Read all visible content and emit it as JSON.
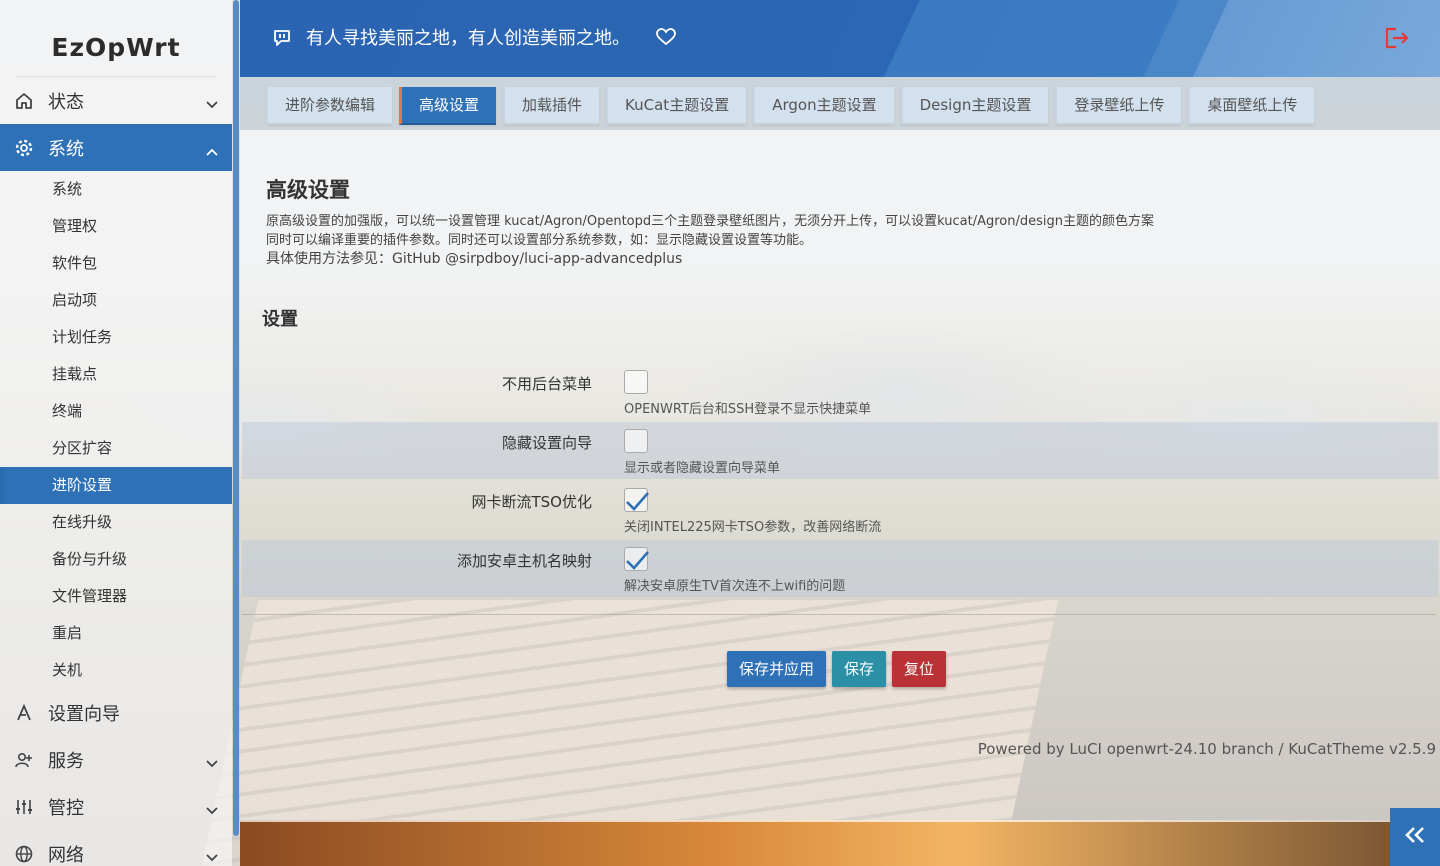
{
  "brand": "EzOpWrt",
  "header": {
    "slogan": "有人寻找美丽之地，有人创造美丽之地。"
  },
  "sidebar": {
    "items": [
      {
        "label": "状态",
        "icon": "home-icon"
      },
      {
        "label": "系统",
        "icon": "gear-icon"
      },
      {
        "label": "设置向导",
        "icon": "wizard-icon"
      },
      {
        "label": "服务",
        "icon": "user-plus-icon"
      },
      {
        "label": "管控",
        "icon": "sliders-icon"
      },
      {
        "label": "网络",
        "icon": "globe-icon"
      }
    ],
    "subitems": [
      "系统",
      "管理权",
      "软件包",
      "启动项",
      "计划任务",
      "挂载点",
      "终端",
      "分区扩容",
      "进阶设置",
      "在线升级",
      "备份与升级",
      "文件管理器",
      "重启",
      "关机"
    ],
    "active_sub": "进阶设置"
  },
  "tabs": [
    "进阶参数编辑",
    "高级设置",
    "加载插件",
    "KuCat主题设置",
    "Argon主题设置",
    "Design主题设置",
    "登录壁纸上传",
    "桌面壁纸上传"
  ],
  "page": {
    "title": "高级设置",
    "desc1": "原高级设置的加强版，可以统一设置管理 kucat/Agron/Opentopd三个主题登录壁纸图片，无须分开上传，可以设置kucat/Agron/design主题的颜色方案",
    "desc2": "同时可以编译重要的插件参数。同时还可以设置部分系统参数，如：显示隐藏设置设置等功能。",
    "desc3": "具体使用方法参见：GitHub @sirpdboy/luci-app-advancedplus",
    "section": "设置"
  },
  "options": [
    {
      "label": "不用后台菜单",
      "hint": "OPENWRT后台和SSH登录不显示快捷菜单",
      "checked": false
    },
    {
      "label": "隐藏设置向导",
      "hint": "显示或者隐藏设置向导菜单",
      "checked": false
    },
    {
      "label": "网卡断流TSO优化",
      "hint": "关闭INTEL225网卡TSO参数，改善网络断流",
      "checked": true
    },
    {
      "label": "添加安卓主机名映射",
      "hint": "解决安卓原生TV首次连不上wifi的问题",
      "checked": true
    }
  ],
  "buttons": {
    "apply": "保存并应用",
    "save": "保存",
    "reset": "复位"
  },
  "footer": "Powered by LuCI openwrt-24.10 branch / KuCatTheme v2.5.9",
  "colors": {
    "accent": "#2f71b7",
    "save": "#2b8fa6",
    "reset": "#b83236",
    "logout": "#e53935"
  }
}
